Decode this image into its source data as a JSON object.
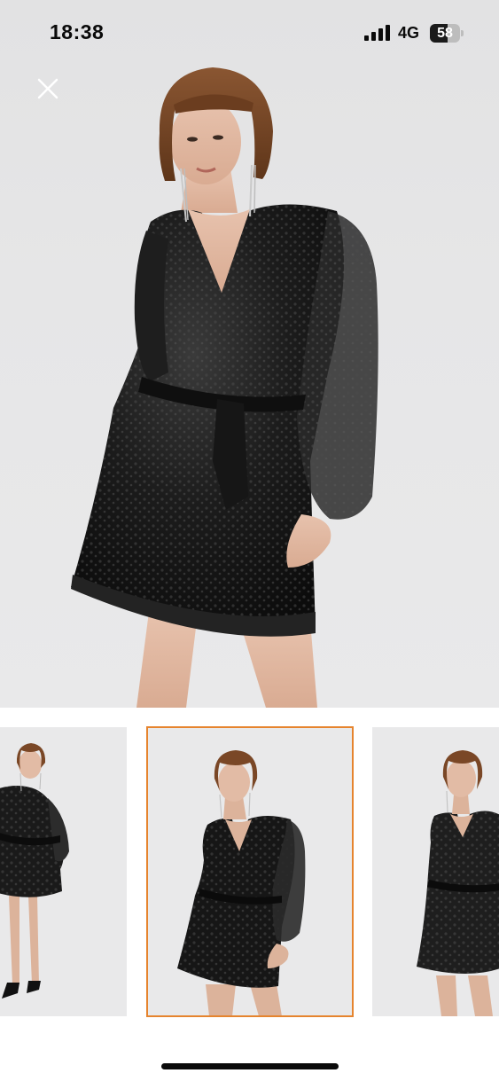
{
  "status_bar": {
    "time": "18:38",
    "network": "4G",
    "battery_level": "58",
    "battery_fraction": 0.58
  },
  "icons": {
    "close": "close-icon",
    "signal": "cellular-signal-icon",
    "battery": "battery-icon"
  },
  "gallery": {
    "selected_index": 1,
    "thumbnail_count": 3,
    "accent_color": "#e6842e"
  },
  "colors": {
    "background": "#ffffff",
    "photo_background": "#e6e6e7",
    "dress": "#141414",
    "hair": "#7a4a28"
  }
}
